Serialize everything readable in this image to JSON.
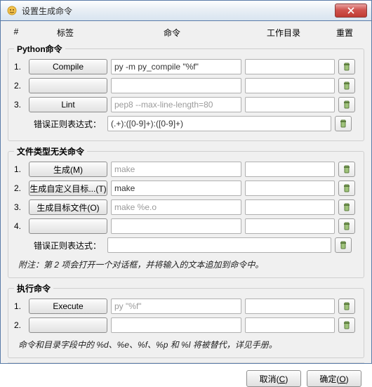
{
  "window": {
    "title": "设置生成命令"
  },
  "columns": {
    "num": "#",
    "label": "标签",
    "cmd": "命令",
    "wd": "工作目录",
    "reset": "重置"
  },
  "sections": {
    "python": {
      "legend": "Python命令",
      "rows": [
        {
          "n": "1.",
          "label": "Compile",
          "cmd": "py -m py_compile \"%f\"",
          "wd": ""
        },
        {
          "n": "2.",
          "label": "",
          "cmd": "",
          "wd": ""
        },
        {
          "n": "3.",
          "label": "Lint",
          "cmd_ph": "pep8 --max-line-length=80",
          "wd": ""
        }
      ],
      "regex_label": "错误正则表达式：",
      "regex_value": "(.+):([0-9]+):([0-9]+)"
    },
    "independent": {
      "legend": "文件类型无关命令",
      "rows": [
        {
          "n": "1.",
          "label": "生成(M)",
          "cmd_ph": "make",
          "wd": ""
        },
        {
          "n": "2.",
          "label": "生成自定义目标...(T)",
          "cmd": "make",
          "wd": ""
        },
        {
          "n": "3.",
          "label": "生成目标文件(O)",
          "cmd_ph": "make %e.o",
          "wd": ""
        },
        {
          "n": "4.",
          "label": "",
          "cmd": "",
          "wd": ""
        }
      ],
      "regex_label": "错误正则表达式：",
      "regex_value": "",
      "note": "附注：第 2 项会打开一个对话框，并将输入的文本追加到命令中。"
    },
    "execute": {
      "legend": "执行命令",
      "rows": [
        {
          "n": "1.",
          "label": "Execute",
          "cmd_ph": "py \"%f\"",
          "wd": ""
        },
        {
          "n": "2.",
          "label": "",
          "cmd": "",
          "wd": ""
        }
      ],
      "note": "命令和目录字段中的 %d、%e、%f、%p 和 %l 将被替代，详见手册。"
    }
  },
  "footer": {
    "cancel": "取消(C)",
    "ok": "确定(O)"
  }
}
